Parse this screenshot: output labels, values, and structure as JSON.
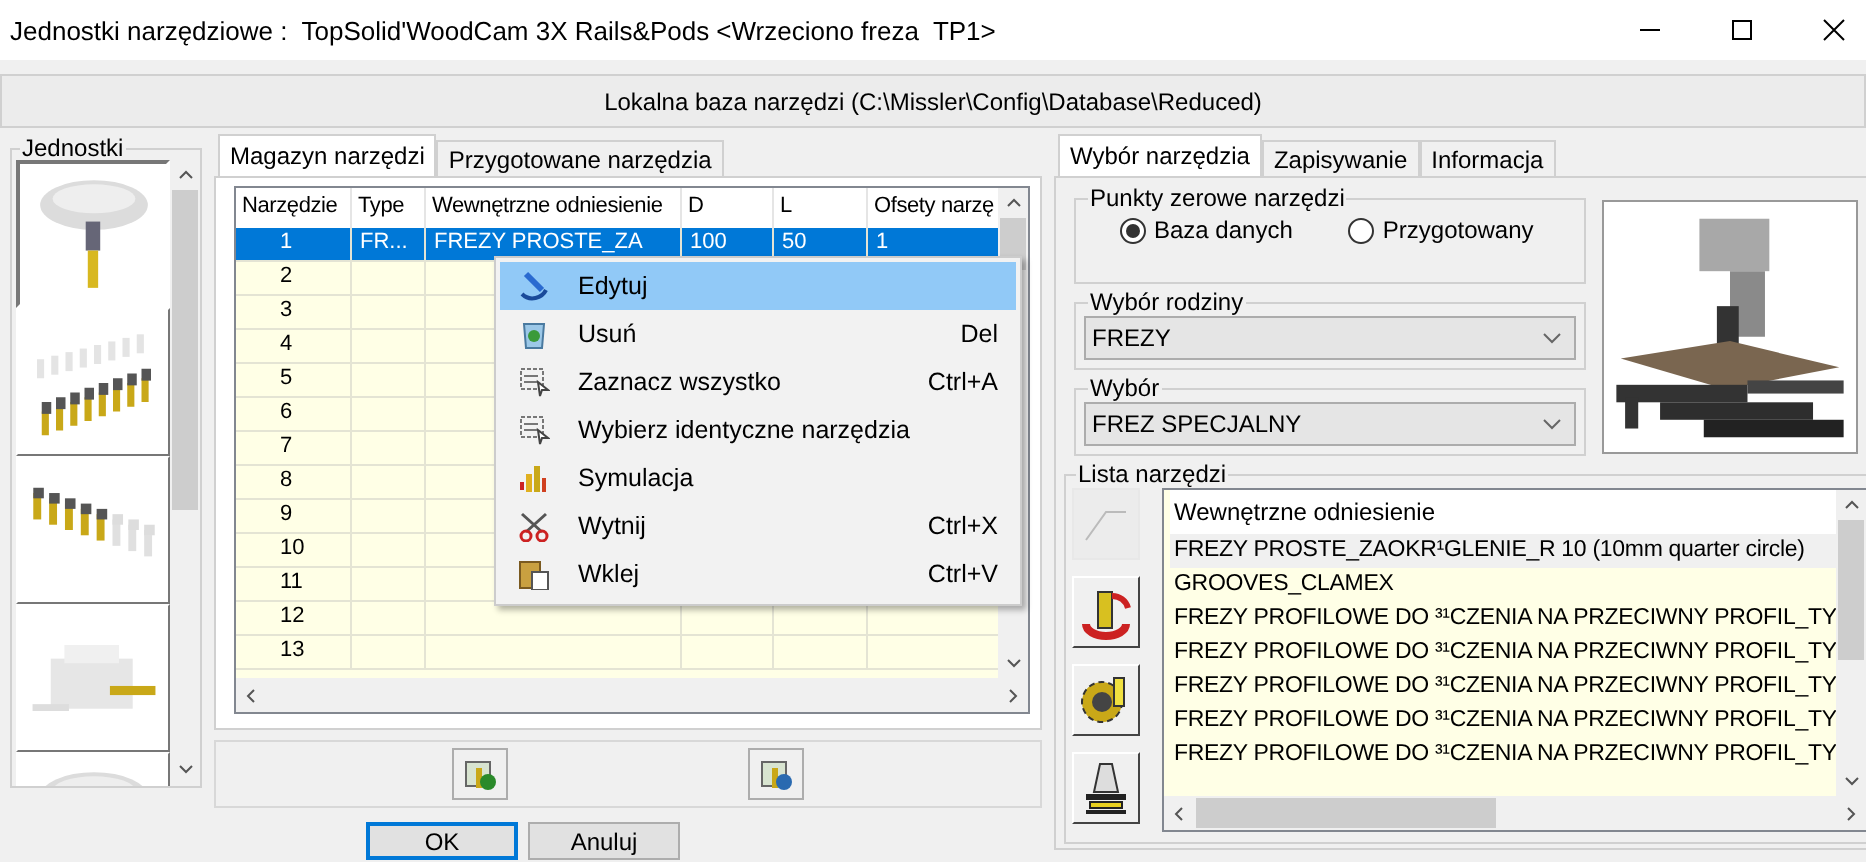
{
  "window": {
    "title": "Jednostki narzędziowe :  TopSolid'WoodCam 3X Rails&Pods <Wrzeciono freza  TP1>"
  },
  "database_bar": {
    "label": "Lokalna baza narzędzi (C:\\Missler\\Config\\Database\\Reduced)"
  },
  "units": {
    "label": "Jednostki",
    "thumbnails": [
      {
        "selected": true
      },
      {
        "selected": false
      },
      {
        "selected": false
      },
      {
        "selected": false
      },
      {
        "selected": false
      }
    ]
  },
  "tool_tabs": [
    {
      "label": "Magazyn narzędzi",
      "selected": true
    },
    {
      "label": "Przygotowane narzędzia",
      "selected": false
    }
  ],
  "table": {
    "columns": [
      "Narzędzie",
      "Type",
      "Wewnętrzne odniesienie",
      "D",
      "L",
      "Ofsety narzę"
    ],
    "rows": [
      {
        "cells": [
          "1",
          "FR...",
          "FREZY PROSTE_ZA",
          "100",
          "50",
          "1"
        ],
        "selected": true
      },
      {
        "cells": [
          "2"
        ],
        "selected": false
      },
      {
        "cells": [
          "3"
        ],
        "selected": false
      },
      {
        "cells": [
          "4"
        ],
        "selected": false
      },
      {
        "cells": [
          "5"
        ],
        "selected": false
      },
      {
        "cells": [
          "6"
        ],
        "selected": false
      },
      {
        "cells": [
          "7"
        ],
        "selected": false
      },
      {
        "cells": [
          "8"
        ],
        "selected": false
      },
      {
        "cells": [
          "9"
        ],
        "selected": false
      },
      {
        "cells": [
          "10"
        ],
        "selected": false
      },
      {
        "cells": [
          "11"
        ],
        "selected": false
      },
      {
        "cells": [
          "12"
        ],
        "selected": false
      },
      {
        "cells": [
          "13"
        ],
        "selected": false
      }
    ]
  },
  "context_menu": {
    "items": [
      {
        "kind": "edit",
        "label": "Edytuj",
        "selected": true
      },
      {
        "kind": "delete",
        "label": "Usuń",
        "shortcut": "Del",
        "selected": false
      },
      {
        "kind": "select-all",
        "label": "Zaznacz wszystko",
        "shortcut": "Ctrl+A",
        "selected": false
      },
      {
        "kind": "select-identical",
        "label": "Wybierz identyczne narzędzia",
        "selected": false
      },
      {
        "kind": "simulation",
        "label": "Symulacja",
        "selected": false
      },
      {
        "kind": "cut",
        "label": "Wytnij",
        "shortcut": "Ctrl+X",
        "selected": false
      },
      {
        "kind": "paste",
        "label": "Wklej",
        "shortcut": "Ctrl+V",
        "selected": false
      }
    ]
  },
  "buttons": [
    {
      "label": "OK",
      "default": true
    },
    {
      "label": "Anuluj",
      "default": false
    }
  ],
  "right_tabs": [
    {
      "label": "Wybór narzędzia",
      "selected": true
    },
    {
      "label": "Zapisywanie",
      "selected": false
    },
    {
      "label": "Informacja",
      "selected": false
    }
  ],
  "zero_points": {
    "label": "Punkty zerowe narzędzi",
    "options": [
      {
        "label": "Baza danych",
        "selected": true
      },
      {
        "label": "Przygotowany",
        "selected": false
      }
    ]
  },
  "family": {
    "label": "Wybór rodziny",
    "value": "FREZY"
  },
  "selection": {
    "label": "Wybór",
    "value": "FREZ SPECJALNY"
  },
  "tool_list": {
    "label": "Lista narzędzi",
    "header": "Wewnętrzne odniesienie",
    "side_buttons": [
      {
        "disabled": true
      },
      {
        "disabled": false
      },
      {
        "disabled": false
      },
      {
        "disabled": false
      }
    ],
    "rows": [
      {
        "text": "FREZY PROSTE_ZAOKR¹GLENIE_R 10 (10mm quarter circle)",
        "selected": true
      },
      {
        "text": "GROOVES_CLAMEX",
        "selected": false
      },
      {
        "text": "FREZY PROFILOWE DO ³¹CZENIA NA PRZECIWNY PROFIL_TY",
        "selected": false
      },
      {
        "text": "FREZY PROFILOWE DO ³¹CZENIA NA PRZECIWNY PROFIL_TY",
        "selected": false
      },
      {
        "text": "FREZY PROFILOWE DO ³¹CZENIA NA PRZECIWNY PROFIL_TY",
        "selected": false
      },
      {
        "text": "FREZY PROFILOWE DO ³¹CZENIA NA PRZECIWNY PROFIL_TY",
        "selected": false
      },
      {
        "text": "FREZY PROFILOWE DO ³¹CZENIA NA PRZECIWNY PROFIL_TY",
        "selected": false
      }
    ]
  }
}
